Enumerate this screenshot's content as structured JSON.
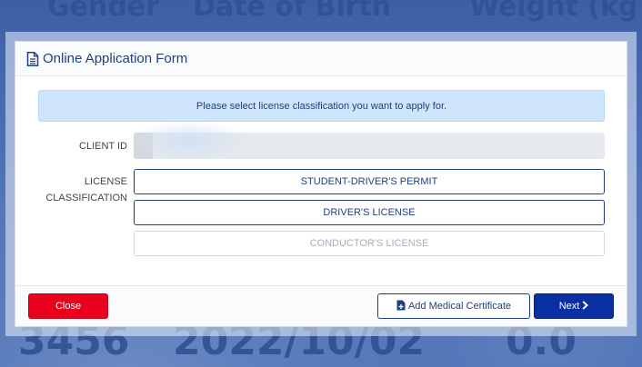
{
  "background": {
    "gender": "Gender",
    "date_of_birth": "Date of Birth",
    "weight": "Weight (kg",
    "number": "3456",
    "date": "2022/10/02",
    "height": "0.0"
  },
  "modal": {
    "title": "Online Application Form",
    "title_icon": "file-text-icon",
    "alert": "Please select license classification you want to apply for.",
    "client_id_label": "CLIENT ID",
    "client_id_value": "",
    "license_label_line1": "LICENSE",
    "license_label_line2": "CLASSIFICATION",
    "options": [
      {
        "label": "STUDENT-DRIVER'S PERMIT",
        "enabled": true
      },
      {
        "label": "DRIVER'S LICENSE",
        "enabled": true
      },
      {
        "label": "CONDUCTOR'S LICENSE",
        "enabled": false
      }
    ]
  },
  "footer": {
    "close_label": "Close",
    "medical_label": "Add Medical Certificate",
    "medical_icon": "file-plus-icon",
    "next_label": "Next",
    "next_icon": "chevron-right-icon"
  },
  "colors": {
    "primary": "#1f3f7f",
    "next_button": "#0a2fa3",
    "close_button": "#e8001c",
    "alert_bg": "#cfe5fb"
  }
}
